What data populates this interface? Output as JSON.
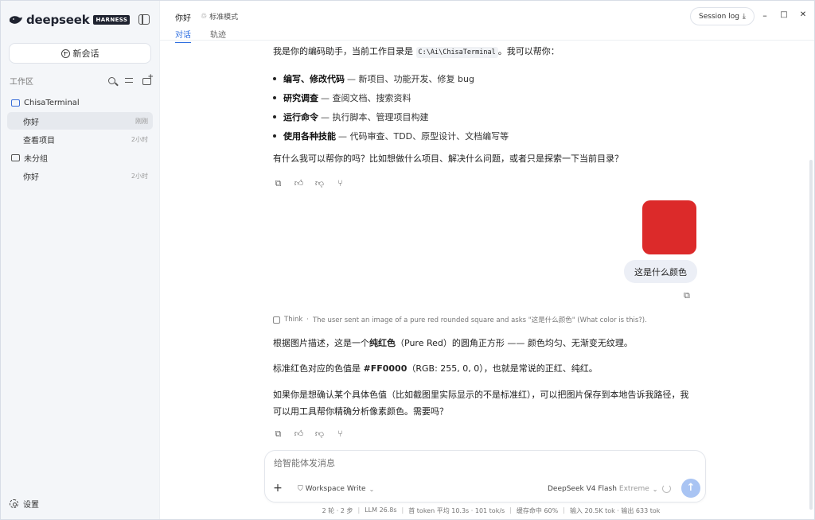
{
  "app": {
    "brand_name": "deepseek",
    "brand_badge": "HARNESS"
  },
  "sidebar": {
    "new_chat_label": "新会话",
    "workspace_title": "工作区",
    "groups": [
      {
        "name": "ChisaTerminal",
        "items": [
          {
            "label": "你好",
            "meta": "刚刚"
          },
          {
            "label": "查看项目",
            "meta": "2小时"
          }
        ]
      },
      {
        "name": "未分组",
        "items": [
          {
            "label": "你好",
            "meta": "2小时"
          }
        ]
      }
    ],
    "settings_label": "设置"
  },
  "topbar": {
    "chat_title": "你好",
    "mode_label": "标准模式",
    "tabs": [
      {
        "label": "对话"
      },
      {
        "label": "轨迹"
      }
    ],
    "session_log_label": "Session log",
    "window_controls": {
      "minimize": "–",
      "maximize": "□",
      "close": "✕"
    }
  },
  "messages": {
    "assistant1": {
      "intro_prefix": "我是你的编码助手，当前工作目录是 ",
      "intro_path": "C:\\Ai\\ChisaTerminal",
      "intro_suffix": "。我可以帮你：",
      "bullets": [
        {
          "bold": "编写、修改代码",
          "text": "— 新项目、功能开发、修复 bug"
        },
        {
          "bold": "研究调查",
          "text": "— 查阅文档、搜索资料"
        },
        {
          "bold": "运行命令",
          "text": "— 执行脚本、管理项目构建"
        },
        {
          "bold": "使用各种技能",
          "text": "— 代码审查、TDD、原型设计、文档编写等"
        }
      ],
      "closing": "有什么我可以帮你的吗？比如想做什么项目、解决什么问题，或者只是探索一下当前目录？"
    },
    "user": {
      "image_color": "#DC2A2A",
      "text": "这是什么颜色"
    },
    "think": {
      "label": "Think",
      "sep": "·",
      "text": "The user sent an image of a pure red rounded square and asks \"这是什么颜色\" (What color is this?)."
    },
    "assistant2": {
      "p1_prefix": "根据图片描述，这是一个",
      "p1_bold": "纯红色",
      "p1_suffix": "（Pure Red）的圆角正方形 —— 颜色均匀、无渐变无纹理。",
      "p2_prefix": "标准红色对应的色值是 ",
      "p2_bold": "#FF0000",
      "p2_suffix": "（RGB: 255, 0, 0），也就是常说的正红、纯红。",
      "p3": "如果你是想确认某个具体色值（比如截图里实际显示的不是标准红），可以把图片保存到本地告诉我路径，我可以用工具帮你精确分析像素颜色。需要吗？"
    }
  },
  "composer": {
    "placeholder": "给智能体发消息",
    "workspace_mode": "Workspace Write",
    "model_name": "DeepSeek V4 Flash",
    "model_level": "Extreme"
  },
  "status": {
    "items": [
      "2 轮 · 2 步",
      "LLM 26.8s",
      "首 token 平均 10.3s · 101 tok/s",
      "缓存命中 60%",
      "输入 20.5K tok · 输出 633 tok"
    ],
    "sep": "|"
  },
  "colors": {
    "accent": "#2F6FE0",
    "send_button": "#A9C4F3",
    "folder_blue": "#3B6FD9"
  }
}
